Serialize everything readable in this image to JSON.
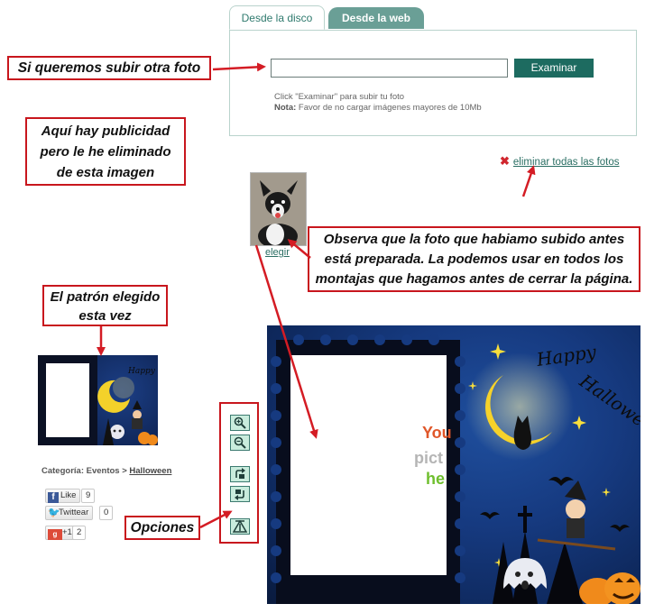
{
  "tabs": {
    "disk": "Desde la disco",
    "web": "Desde la web"
  },
  "upload": {
    "file_value": "",
    "button": "Examinar",
    "hint_line1": "Click \"Examinar\" para subir tu foto",
    "hint_note_label": "Nota:",
    "hint_note_text": " Favor de no cargar imágenes mayores de 10Mb"
  },
  "delete_all": "eliminar todas las fotos",
  "thumb": {
    "choose": "elegir"
  },
  "annotations": {
    "upload_other": "Si queremos subir otra foto",
    "ads_line1": "Aquí hay publicidad",
    "ads_line2": "pero le he eliminado",
    "ads_line3": "de esta imagen",
    "photo_line1": "Observa que la foto que habiamo subido antes",
    "photo_line2": "está preparada. La podemos usar en todos los",
    "photo_line3": "montajas que hagamos antes de cerrar la página.",
    "pattern_line1": "El patrón elegido",
    "pattern_line2": "esta vez",
    "options": "Opciones"
  },
  "category": {
    "label": "Categoría: Eventos > ",
    "link": "Halloween"
  },
  "social": {
    "fb_label": "Like",
    "fb_count": "9",
    "tw_label": "Twittear",
    "tw_count": "0",
    "gp_label": "+1",
    "gp_count": "2"
  },
  "canvas": {
    "placeholder_line1": "You",
    "placeholder_line2": "pict",
    "placeholder_line3": "he",
    "happy": "Happy",
    "halloween": "Halloween"
  },
  "colors": {
    "accent": "#1d6b60",
    "tab_inactive": "#6a9f96",
    "annotation_red": "#c8161d",
    "link": "#2a6e63"
  },
  "icons": [
    "zoom-in-icon",
    "zoom-out-icon",
    "rotate-left-icon",
    "rotate-right-icon",
    "fit-icon",
    "delete-x-icon",
    "facebook-icon",
    "twitter-icon",
    "google-plus-icon"
  ]
}
